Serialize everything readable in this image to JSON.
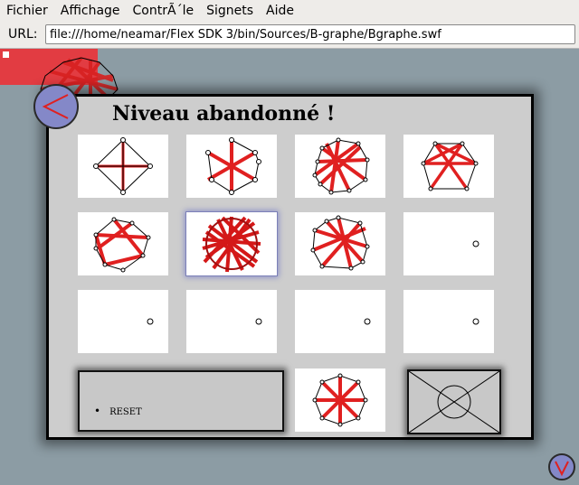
{
  "menu": {
    "items": [
      "Fichier",
      "Affichage",
      "ContrÃ´le",
      "Signets",
      "Aide"
    ]
  },
  "url_bar": {
    "label": "URL:",
    "value": "file:///home/neamar/Flex SDK 3/bin/Sources/B-graphe/Bgraphe.swf"
  },
  "panel": {
    "title": "Niveau abandonné !",
    "reset_label": "RESET"
  },
  "colors": {
    "background": "#8c9ca4",
    "edge_red": "#e02020",
    "accent_button": "#8488c8",
    "panel": "#cdcdcd"
  },
  "icons": {
    "back": "chevron-left-icon",
    "down": "chevron-down-icon",
    "close": "envelope-close-icon"
  }
}
